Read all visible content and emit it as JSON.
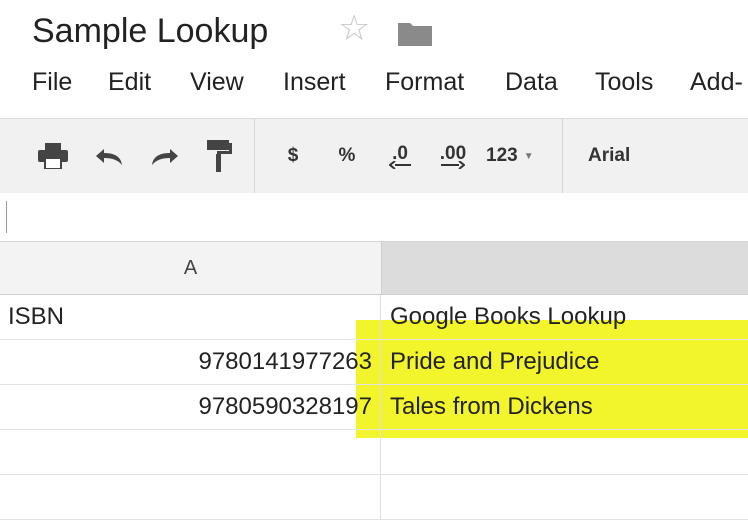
{
  "app": {
    "title": "Sample Lookup",
    "star_icon": "star-outline-icon",
    "folder_icon": "folder-icon"
  },
  "menu": {
    "items": [
      "File",
      "Edit",
      "View",
      "Insert",
      "Format",
      "Data",
      "Tools",
      "Add-"
    ]
  },
  "toolbar": {
    "currency_label": "$",
    "percent_label": "%",
    "decrease_decimal_label": ".0",
    "increase_decimal_label": ".00",
    "number_format_label": "123",
    "font_label": "Arial"
  },
  "columns": {
    "a_header": "A",
    "b_header": ""
  },
  "rows": [
    {
      "a": "ISBN",
      "b": "Google Books Lookup"
    },
    {
      "a": "9780141977263",
      "b": "Pride and Prejudice"
    },
    {
      "a": "9780590328197",
      "b": "Tales from Dickens"
    },
    {
      "a": "",
      "b": ""
    },
    {
      "a": "",
      "b": ""
    }
  ],
  "colors": {
    "highlight": "#f3f52c",
    "toolbar_bg": "#f1f1f1"
  }
}
